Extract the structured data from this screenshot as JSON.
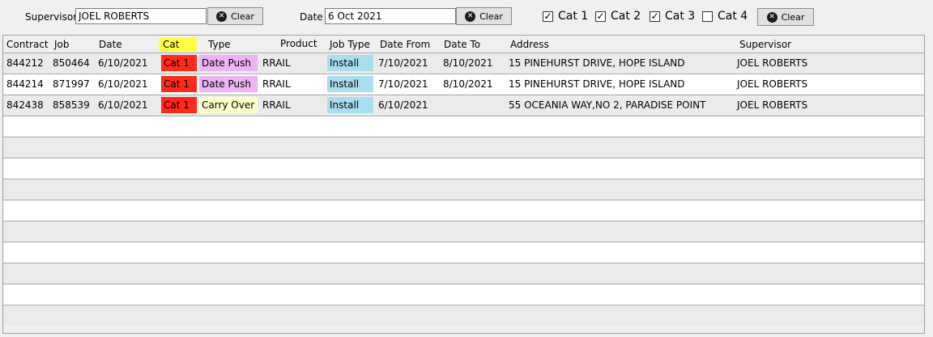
{
  "filters": {
    "supervisor_label": "Supervisor :",
    "supervisor_value": "JOEL ROBERTS",
    "date_label": "Date :",
    "date_value": "6 Oct 2021",
    "clear_label": "Clear",
    "categories": [
      {
        "label": "Cat 1",
        "checked": true
      },
      {
        "label": "Cat 2",
        "checked": true
      },
      {
        "label": "Cat 3",
        "checked": true
      },
      {
        "label": "Cat 4",
        "checked": false
      }
    ]
  },
  "colors": {
    "cat_header": "#ffff44",
    "cat1": "#ff2a1a",
    "date_push": "#eeb3f5",
    "carry_over": "#ffffcc",
    "install": "#a8def0"
  },
  "icons": {
    "clear": "close-circle-icon",
    "checkbox": "checkmark-icon"
  },
  "table": {
    "headers": [
      "Contract",
      "Job",
      "Date",
      "Cat",
      "Type",
      "Product",
      "Job Type",
      "Date From",
      "Date To",
      "Address",
      "Supervisor"
    ],
    "rows": [
      {
        "contract": "844212",
        "job": "850464",
        "date": "6/10/2021",
        "cat": "Cat 1",
        "type": "Date Push",
        "product": "RRAIL",
        "job_type": "Install",
        "date_from": "7/10/2021",
        "date_to": "8/10/2021",
        "address": "15 PINEHURST DRIVE, HOPE ISLAND",
        "supervisor": "JOEL ROBERTS"
      },
      {
        "contract": "844214",
        "job": "871997",
        "date": "6/10/2021",
        "cat": "Cat 1",
        "type": "Date Push",
        "product": "RRAIL",
        "job_type": "Install",
        "date_from": "7/10/2021",
        "date_to": "8/10/2021",
        "address": "15 PINEHURST DRIVE, HOPE ISLAND",
        "supervisor": "JOEL ROBERTS"
      },
      {
        "contract": "842438",
        "job": "858539",
        "date": "6/10/2021",
        "cat": "Cat 1",
        "type": "Carry Over",
        "product": "RRAIL",
        "job_type": "Install",
        "date_from": "6/10/2021",
        "date_to": "",
        "address": "55 OCEANIA WAY,NO 2, PARADISE POINT",
        "supervisor": "JOEL ROBERTS"
      }
    ],
    "empty_rows": 10
  }
}
